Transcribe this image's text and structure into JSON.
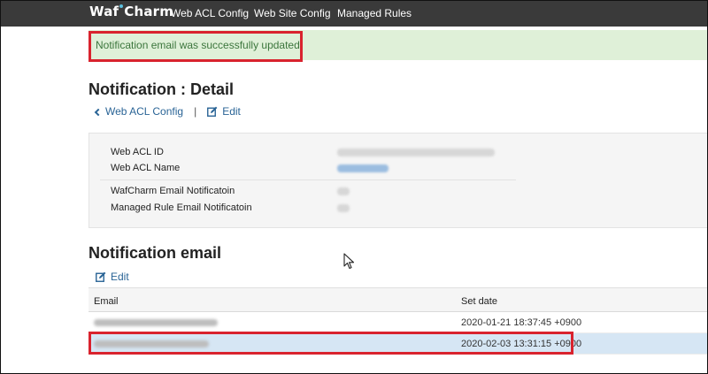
{
  "navbar": {
    "brand_left": "Waf",
    "brand_right": "Charm",
    "items": [
      "Web ACL Config",
      "Web Site Config",
      "Managed Rules"
    ]
  },
  "alert": {
    "message": "Notification email was successfully updated."
  },
  "page": {
    "title": "Notification : Detail",
    "back_link": "Web ACL Config",
    "separator": "|",
    "edit_link": "Edit"
  },
  "detail": {
    "fields": [
      {
        "label": "Web ACL ID"
      },
      {
        "label": "Web ACL Name"
      },
      {
        "label": "WafCharm Email Notificatoin"
      },
      {
        "label": "Managed Rule Email Notificatoin"
      }
    ]
  },
  "notification_email": {
    "title": "Notification email",
    "edit_link": "Edit",
    "columns": [
      "Email",
      "Set date"
    ],
    "rows": [
      {
        "set_date": "2020-01-21 18:37:45 +0900",
        "selected": false
      },
      {
        "set_date": "2020-02-03 13:31:15 +0900",
        "selected": true
      }
    ]
  },
  "colors": {
    "navbar_bg": "#3a3a3a",
    "alert_bg": "#dff0d8",
    "alert_text": "#3c763d",
    "link": "#2a6496",
    "highlight_border": "#d9232e",
    "selected_row": "#d6e6f4"
  },
  "icons": {
    "back": "chevron-left-icon",
    "edit": "edit-icon",
    "cursor": "mouse-cursor-icon"
  }
}
